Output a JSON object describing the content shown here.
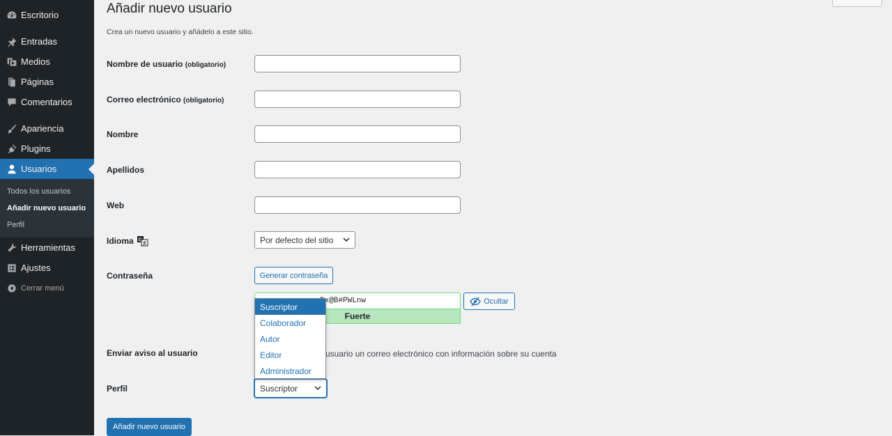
{
  "sidebar": {
    "items": [
      {
        "label": "Escritorio",
        "icon": "dashboard-icon"
      },
      {
        "label": "Entradas",
        "icon": "pin-icon"
      },
      {
        "label": "Medios",
        "icon": "media-icon"
      },
      {
        "label": "Páginas",
        "icon": "page-icon"
      },
      {
        "label": "Comentarios",
        "icon": "comment-icon"
      },
      {
        "label": "Apariencia",
        "icon": "brush-icon"
      },
      {
        "label": "Plugins",
        "icon": "plug-icon"
      },
      {
        "label": "Usuarios",
        "icon": "user-icon"
      },
      {
        "label": "Herramientas",
        "icon": "wrench-icon"
      },
      {
        "label": "Ajustes",
        "icon": "settings-icon"
      }
    ],
    "submenu": [
      "Todos los usuarios",
      "Añadir nuevo usuario",
      "Perfil"
    ],
    "collapse_label": "Cerrar menú",
    "accent": "#2271b1"
  },
  "page": {
    "title": "Añadir nuevo usuario",
    "description": "Crea un nuevo usuario y añádelo a este sitio."
  },
  "form": {
    "username_label": "Nombre de usuario",
    "email_label": "Correo electrónico",
    "required_note": "(obligatorio)",
    "first_name_label": "Nombre",
    "last_name_label": "Apellidos",
    "website_label": "Web",
    "language_label": "Idioma",
    "language_value": "Por defecto del sitio",
    "password_label": "Contraseña",
    "generate_password_button": "Generar contraseña",
    "password_value": "Px@B#PWLnw",
    "hide_button": "Ocultar",
    "strength": "Fuerte",
    "notify_label": "Enviar aviso al usuario",
    "notify_text": "usuario un correo electrónico con información sobre su cuenta",
    "role_label": "Perfil",
    "role_value": "Suscriptor",
    "role_options": [
      "Suscriptor",
      "Colaborador",
      "Autor",
      "Editor",
      "Administrador"
    ],
    "submit_button": "Añadir nuevo usuario"
  }
}
